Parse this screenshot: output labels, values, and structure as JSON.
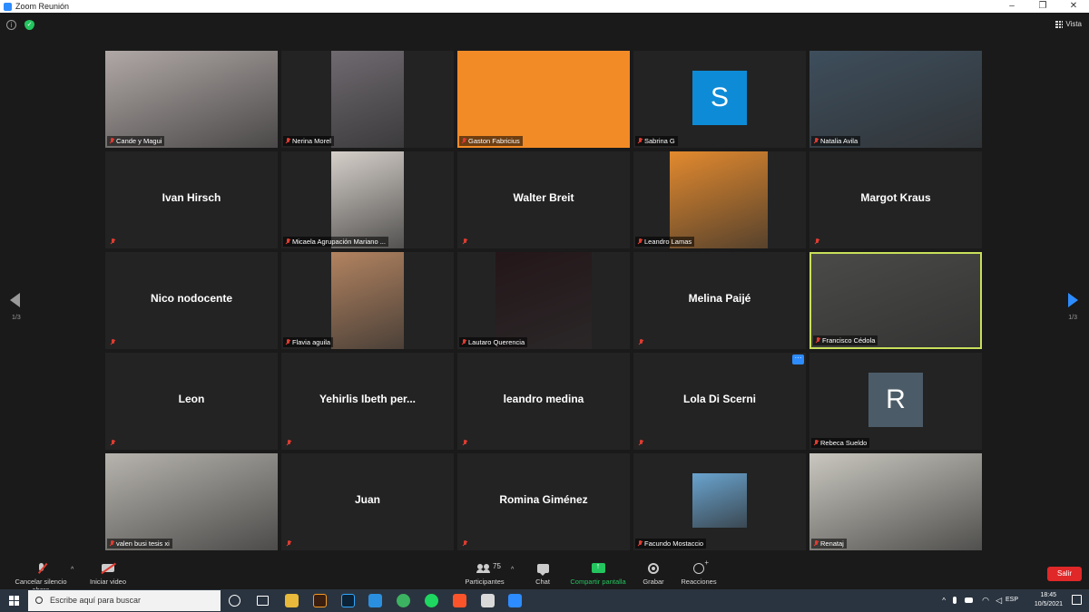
{
  "window": {
    "title": "Zoom Reunión",
    "minimize": "–",
    "maximize": "❐",
    "close": "✕"
  },
  "topbar": {
    "view_label": "Vista"
  },
  "pager": {
    "left": "1/3",
    "right": "1/3"
  },
  "tiles": [
    {
      "label": "Cande y Magui",
      "kind": "video",
      "photo": "#b0a8a6"
    },
    {
      "label": "Nerina Morel",
      "kind": "video",
      "photo": "#6f6a70"
    },
    {
      "label": "Gaston Fabricius",
      "kind": "color",
      "color": "#f28b26"
    },
    {
      "label": "Sabrina G",
      "kind": "avatar",
      "letter": "S",
      "color": "#0e8bd6"
    },
    {
      "label": "Natalia Avila",
      "kind": "video",
      "photo": "#3e4e5c"
    },
    {
      "label": "Ivan Hirsch",
      "kind": "name"
    },
    {
      "label": "Micaela  Agrupación Mariano ...",
      "kind": "video",
      "photo": "#d6d0ca"
    },
    {
      "label": "Walter Breit",
      "kind": "name"
    },
    {
      "label": "Leandro Lamas",
      "kind": "video",
      "photo": "#e38a2e"
    },
    {
      "label": "Margot Kraus",
      "kind": "name"
    },
    {
      "label": "Nico nodocente",
      "kind": "name"
    },
    {
      "label": "Flavia aguila",
      "kind": "video",
      "photo": "#b28360"
    },
    {
      "label": "Lautaro Querencia",
      "kind": "video",
      "photo": "#241619"
    },
    {
      "label": "Melina Paijé",
      "kind": "name"
    },
    {
      "label": "Francisco Cédola",
      "kind": "video",
      "photo": "#4a4a48",
      "active": true
    },
    {
      "label": "Leon",
      "kind": "name"
    },
    {
      "label": "Yehirlis Ibeth per...",
      "kind": "name"
    },
    {
      "label": "leandro medina",
      "kind": "name"
    },
    {
      "label": "Lola Di Scerni",
      "kind": "name",
      "more": true
    },
    {
      "label": "Rebeca Sueldo",
      "kind": "avatar",
      "letter": "R",
      "color": "#4b5c68"
    },
    {
      "label": "valen busi tesis xi",
      "kind": "video",
      "photo": "#b7b4ae"
    },
    {
      "label": "Juan",
      "kind": "name"
    },
    {
      "label": "Romina Giménez",
      "kind": "name"
    },
    {
      "label": "Facundo Mostaccio",
      "kind": "video",
      "photo": "#6aa4cf"
    },
    {
      "label": "Renataj",
      "kind": "video",
      "photo": "#c9c7bf"
    }
  ],
  "toolbar": {
    "unmute_label": "Cancelar silencio ahora",
    "start_video_label": "Iniciar video",
    "participants_label": "Participantes",
    "participants_count": "75",
    "chat_label": "Chat",
    "share_label": "Compartir pantalla",
    "record_label": "Grabar",
    "reactions_label": "Reacciones",
    "leave_label": "Salir"
  },
  "taskbar": {
    "search_placeholder": "Escribe aquí para buscar",
    "language": "ESP",
    "time": "18:45",
    "date": "10/5/2021"
  }
}
